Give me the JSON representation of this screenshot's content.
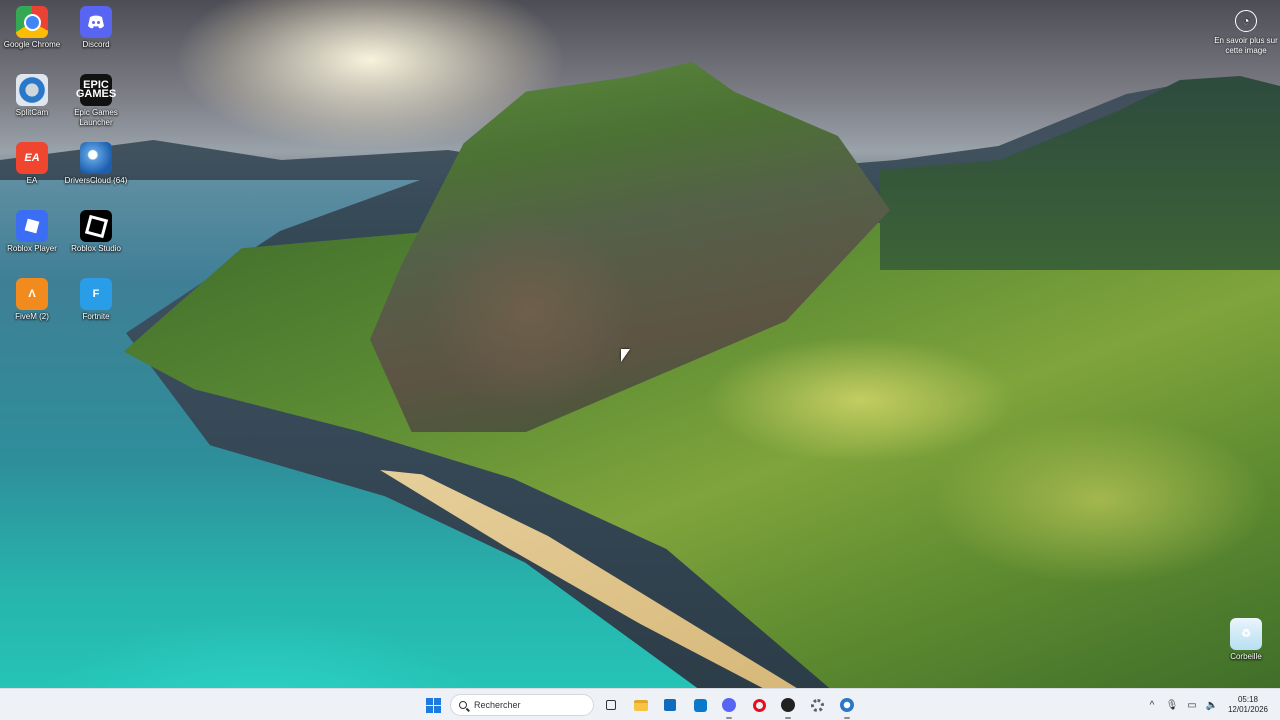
{
  "desktop": {
    "icons": [
      {
        "label": "Google Chrome",
        "icon": "chrome-icon"
      },
      {
        "label": "Discord",
        "icon": "discord-icon"
      },
      {
        "label": "SplitCam",
        "icon": "splitcam-icon"
      },
      {
        "label": "Epic Games Launcher",
        "icon": "epic-games-icon",
        "glyph": "EPIC GAMES"
      },
      {
        "label": "EA",
        "icon": "ea-icon",
        "glyph": "EA"
      },
      {
        "label": "DriversCloud (64)",
        "icon": "driverscloud-icon"
      },
      {
        "label": "Roblox Player",
        "icon": "roblox-icon"
      },
      {
        "label": "Roblox Studio",
        "icon": "roblox-studio-icon"
      },
      {
        "label": "FiveM (2)",
        "icon": "fivem-icon",
        "glyph": "Λ"
      },
      {
        "label": "Fortnite",
        "icon": "fortnite-icon",
        "glyph": "F"
      }
    ],
    "recycle_bin": {
      "label": "Corbeille",
      "icon": "recycle-bin-icon",
      "glyph": "♻"
    },
    "spotlight": {
      "label": "En savoir plus sur cette image",
      "icon": "spotlight-camera-icon",
      "glyph": "◔"
    }
  },
  "taskbar": {
    "search_placeholder": "Rechercher",
    "apps": [
      {
        "name": "task-view",
        "icon": "task-view-icon"
      },
      {
        "name": "file-explorer",
        "icon": "folder-icon"
      },
      {
        "name": "microsoft-store",
        "icon": "store-icon"
      },
      {
        "name": "app",
        "icon": "app-icon"
      },
      {
        "name": "discord",
        "icon": "discord-icon"
      },
      {
        "name": "opera",
        "icon": "opera-icon"
      },
      {
        "name": "app",
        "icon": "app-icon"
      },
      {
        "name": "settings",
        "icon": "gear-icon"
      },
      {
        "name": "splitcam",
        "icon": "splitcam-icon"
      }
    ],
    "tray": {
      "chevron": "^",
      "mic": "🎙",
      "network": "▭",
      "volume": "🔈"
    },
    "clock": {
      "time": "05:18",
      "date": "12/01/2026"
    }
  },
  "colors": {
    "taskbar_bg": "#eef1f6",
    "accent": "#1f7ae0"
  }
}
